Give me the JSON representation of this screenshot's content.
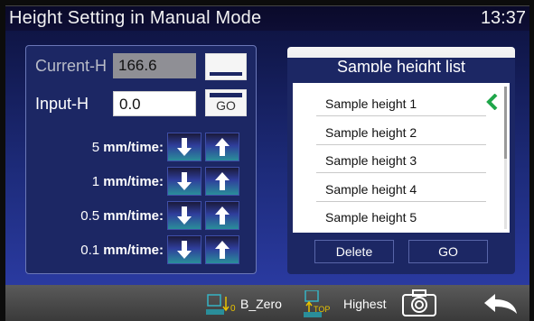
{
  "header": {
    "title": "Height Setting in Manual Mode",
    "time": "13:37"
  },
  "left_panel": {
    "current_label": "Current-H",
    "current_value": "166.6",
    "input_label": "Input-H",
    "input_value": "0.0",
    "go_label": "GO",
    "steps": [
      {
        "num": "5",
        "unit": " mm/time:"
      },
      {
        "num": "1",
        "unit": " mm/time:"
      },
      {
        "num": "0.5",
        "unit": " mm/time:"
      },
      {
        "num": "0.1",
        "unit": " mm/time:"
      }
    ]
  },
  "sample_list": {
    "title": "Sample height list",
    "items": [
      "Sample height 1",
      "Sample height 2",
      "Sample height 3",
      "Sample height 4",
      "Sample height 5"
    ],
    "selected_index": 0,
    "delete_label": "Delete",
    "go_label": "GO"
  },
  "toolbar": {
    "b_zero_mark": "0",
    "b_zero_label": "B_Zero",
    "top_mark": "TOP",
    "highest_label": "Highest",
    "icons": [
      "b-zero-icon",
      "highest-icon",
      "camera-icon",
      "back-arrow-icon"
    ]
  },
  "colors": {
    "panel": "#1c2764",
    "accent_teal": "#2a8e9a",
    "check_green": "#1fa64a"
  }
}
